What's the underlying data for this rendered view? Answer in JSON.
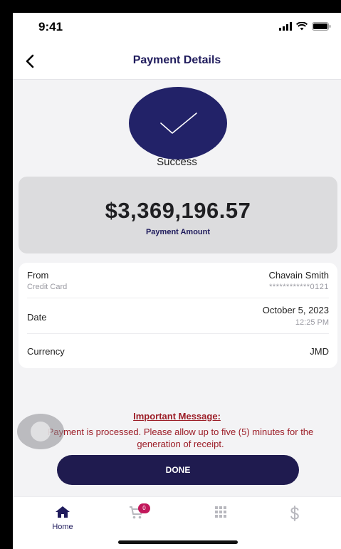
{
  "status_bar": {
    "time": "9:41"
  },
  "header": {
    "title": "Payment Details"
  },
  "success": {
    "label": "Success"
  },
  "amount": {
    "value": "$3,369,196.57",
    "label": "Payment Amount"
  },
  "details": {
    "from": {
      "label": "From",
      "sub_label": "Credit Card",
      "name": "Chavain Smith",
      "card": "************0121"
    },
    "date": {
      "label": "Date",
      "value": "October 5, 2023",
      "time": "12:25 PM"
    },
    "currency": {
      "label": "Currency",
      "value": "JMD"
    }
  },
  "message": {
    "title": "Important Message:",
    "body": "Payment is processed. Please allow up to five (5) minutes for the generation of receipt."
  },
  "done_button": {
    "label": "DONE"
  },
  "bottom_nav": {
    "home_label": "Home",
    "cart_badge": "0",
    "items": [
      "home-icon",
      "cart-icon",
      "grid-icon",
      "dollar-icon"
    ]
  },
  "colors": {
    "primary": "#1f1b5c",
    "success_circle": "#222268",
    "alert": "#9c1d27",
    "badge": "#c2185b"
  }
}
